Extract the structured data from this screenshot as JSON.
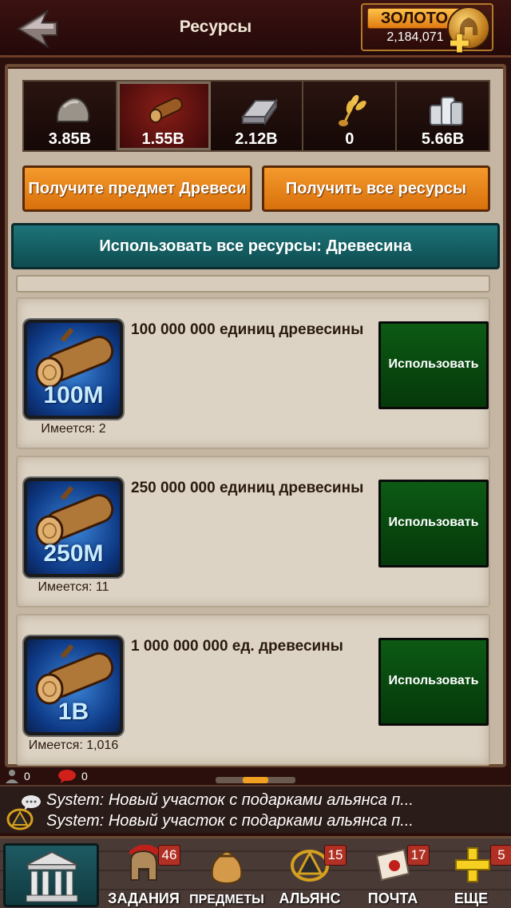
{
  "header": {
    "title": "Ресурсы",
    "back_icon": "back-arrow-icon",
    "gold": {
      "label": "ЗОЛОТО",
      "amount": "2,184,071"
    }
  },
  "resources": [
    {
      "name": "stone",
      "icon": "stone-icon",
      "value": "3.85B",
      "selected": false
    },
    {
      "name": "wood",
      "icon": "wood-log-icon",
      "value": "1.55B",
      "selected": true
    },
    {
      "name": "ore",
      "icon": "iron-ingot-icon",
      "value": "2.12B",
      "selected": false
    },
    {
      "name": "food",
      "icon": "wheat-icon",
      "value": "0",
      "selected": false
    },
    {
      "name": "silver",
      "icon": "silver-coins-icon",
      "value": "5.66B",
      "selected": false
    }
  ],
  "actions": {
    "get_item": "Получите предмет Древеси",
    "get_all": "Получить все ресурсы",
    "use_all": "Использовать все ресурсы: Древесина"
  },
  "items": [
    {
      "badge": "100M",
      "title": "100 000 000 единиц древесины",
      "have": "Имеется: 2",
      "use": "Использовать"
    },
    {
      "badge": "250M",
      "title": "250 000 000 единиц древесины",
      "have": "Имеется: 11",
      "use": "Использовать"
    },
    {
      "badge": "1B",
      "title": "1 000 000 000 ед. древесины",
      "have": "Имеется: 1,016",
      "use": "Использовать"
    }
  ],
  "status": {
    "players": "0",
    "messages": "0"
  },
  "chat": [
    {
      "sender": "System:",
      "text": "Новый участок с подарками альянса п..."
    },
    {
      "sender": "System:",
      "text": "Новый участок с подарками альянса п..."
    }
  ],
  "nav": [
    {
      "label": "ЗАДАНИЯ",
      "badge": "46",
      "icon": "spartan-helmet-icon"
    },
    {
      "label": "ПРЕДМЕТЫ",
      "badge": "",
      "icon": "item-bag-icon"
    },
    {
      "label": "АЛЬЯНС",
      "badge": "15",
      "icon": "alliance-emblem-icon"
    },
    {
      "label": "ПОЧТА",
      "badge": "17",
      "icon": "mail-scroll-icon"
    },
    {
      "label": "ЕЩЕ",
      "badge": "5",
      "icon": "plus-icon"
    }
  ],
  "colors": {
    "gold_accent": "#f49a2c",
    "teal_button": "#1d7478",
    "use_button": "#0c5a14",
    "badge_red": "#b03024"
  }
}
